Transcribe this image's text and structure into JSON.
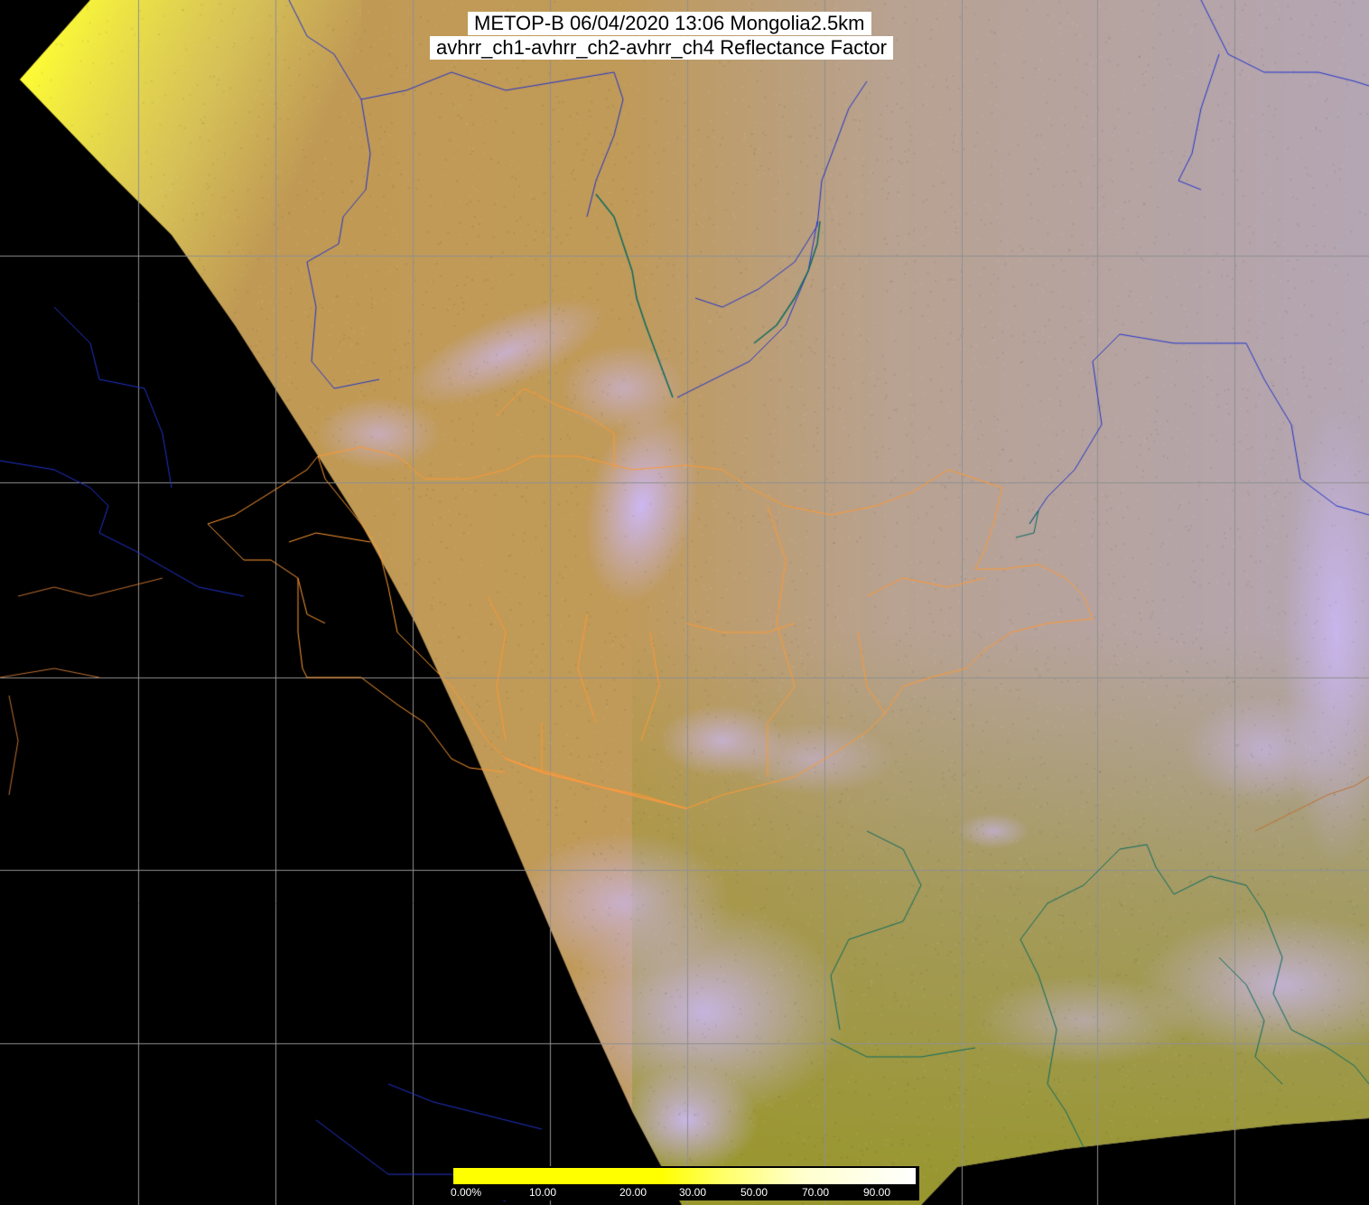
{
  "title": {
    "line1": "METOP-B 06/04/2020 13:06 Mongolia2.5km",
    "line2": "avhrr_ch1-avhrr_ch2-avhrr_ch4 Reflectance Factor"
  },
  "colorbar": {
    "ticks": [
      "0.00%",
      "10.00",
      "20.00",
      "30.00",
      "50.00",
      "70.00",
      "90.00"
    ],
    "colors": [
      "#ffff00",
      "#ffff66",
      "#ffffcc",
      "#ffffff"
    ]
  },
  "colors": {
    "background": "#000000",
    "land_north": "#c19a52",
    "land_east": "#b8a291",
    "land_south": "#9a9535",
    "cloud": "#c9b3f5",
    "edge_yellow": "#ffff33",
    "rivers": "#2233cc",
    "coast": "#0a6a60",
    "borders": "#ff9933",
    "grid": "#909090"
  }
}
